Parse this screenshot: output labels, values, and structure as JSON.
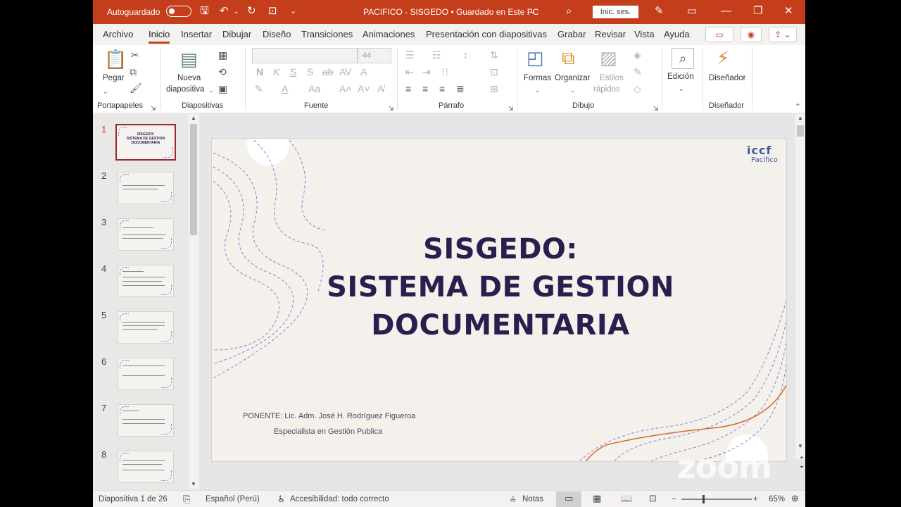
{
  "titlebar": {
    "autosave_label": "Autoguardado",
    "document_title": "PACIFICO - SISGEDO  •  Guardado en Este PC",
    "signin_label": "Inic. ses."
  },
  "menu": {
    "tabs": [
      "Archivo",
      "Inicio",
      "Insertar",
      "Dibujar",
      "Diseño",
      "Transiciones",
      "Animaciones",
      "Presentación con diapositivas",
      "Grabar",
      "Revisar",
      "Vista",
      "Ayuda"
    ],
    "active_tab": "Inicio"
  },
  "ribbon": {
    "paste_label": "Pegar",
    "new_slide_label_1": "Nueva",
    "new_slide_label_2": "diapositiva",
    "font_size_value": "44",
    "shapes_label": "Formas",
    "arrange_label": "Organizar",
    "quick_styles_label_1": "Estilos",
    "quick_styles_label_2": "rápidos",
    "editing_label": "Edición",
    "designer_label": "Diseñador",
    "groups": {
      "clipboard": "Portapapeles",
      "slides": "Diapositivas",
      "font": "Fuente",
      "paragraph": "Párrafo",
      "drawing": "Dibujo",
      "designer": "Diseñador"
    }
  },
  "thumbnails": {
    "numbers": [
      "1",
      "2",
      "3",
      "4",
      "5",
      "6",
      "7",
      "8"
    ],
    "selected": "1",
    "first_thumb_title": "SISGEDO:\nSISTEMA DE GESTION\nDOCUMENTARIA"
  },
  "slide": {
    "title_line1": "SISGEDO:",
    "title_line2": "SISTEMA DE GESTION",
    "title_line3": "DOCUMENTARIA",
    "presenter": "PONENTE: Lic. Adm. José H. Rodríguez Figueroa",
    "specialty": "Especialista en Gestión Publica",
    "logo_main": "iccf",
    "logo_sub": "Pacifico"
  },
  "status": {
    "slide_counter": "Diapositiva 1 de 26",
    "language": "Español (Perú)",
    "accessibility": "Accesibilidad: todo correcto",
    "notes_label": "Notas",
    "zoom_level": "65%"
  },
  "watermark": "zoom",
  "colors": {
    "accent": "#c43e1c",
    "slide_bg": "#f4f1ec",
    "title_color": "#2a1e4e"
  }
}
